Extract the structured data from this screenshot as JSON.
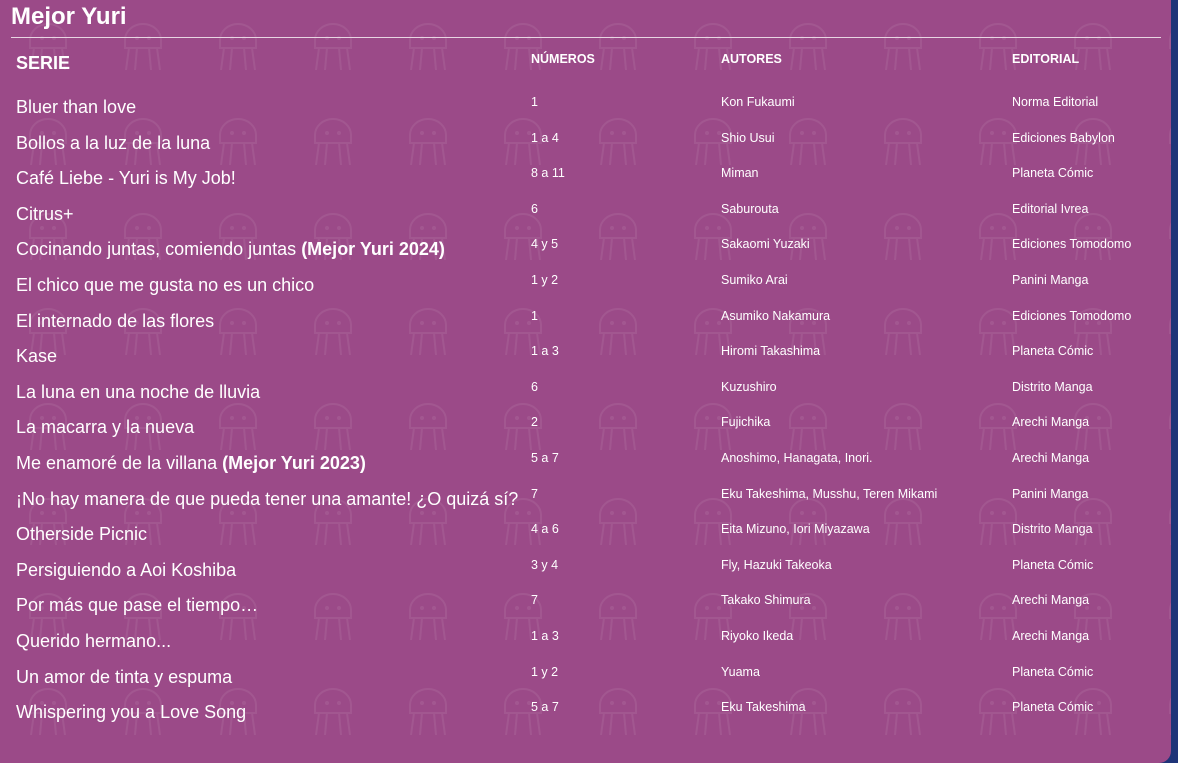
{
  "section": {
    "title": "Mejor Yuri"
  },
  "table": {
    "headers": {
      "serie": "SERIE",
      "numeros": "NÚMEROS",
      "autores": "AUTORES",
      "editorial": "EDITORIAL"
    },
    "rows": [
      {
        "serie": "Bluer than love",
        "award": "",
        "numeros": "1",
        "autores": "Kon Fukaumi",
        "editorial": "Norma Editorial"
      },
      {
        "serie": "Bollos a la luz de la luna",
        "award": "",
        "numeros": "1 a 4",
        "autores": "Shio Usui",
        "editorial": "Ediciones Babylon"
      },
      {
        "serie": "Café Liebe - Yuri is My Job!",
        "award": "",
        "numeros": "8 a 11",
        "autores": "Miman",
        "editorial": "Planeta Cómic"
      },
      {
        "serie": "Citrus+",
        "award": "",
        "numeros": "6",
        "autores": "Saburouta",
        "editorial": "Editorial Ivrea"
      },
      {
        "serie": "Cocinando juntas, comiendo juntas ",
        "award": "(Mejor Yuri 2024)",
        "numeros": "4 y 5",
        "autores": "Sakaomi Yuzaki",
        "editorial": "Ediciones Tomodomo"
      },
      {
        "serie": "El chico que me gusta no es un chico",
        "award": "",
        "numeros": "1 y 2",
        "autores": "Sumiko Arai",
        "editorial": "Panini Manga"
      },
      {
        "serie": "El internado de las flores",
        "award": "",
        "numeros": "1",
        "autores": "Asumiko Nakamura",
        "editorial": "Ediciones Tomodomo"
      },
      {
        "serie": "Kase",
        "award": "",
        "numeros": "1 a 3",
        "autores": "Hiromi Takashima",
        "editorial": "Planeta Cómic"
      },
      {
        "serie": "La luna en una noche de lluvia",
        "award": "",
        "numeros": "6",
        "autores": "Kuzushiro",
        "editorial": "Distrito Manga"
      },
      {
        "serie": "La macarra y la nueva",
        "award": "",
        "numeros": "2",
        "autores": "Fujichika",
        "editorial": "Arechi Manga"
      },
      {
        "serie": "Me enamoré de la villana ",
        "award": "(Mejor Yuri 2023)",
        "numeros": "5 a 7",
        "autores": "Anoshimo, Hanagata, Inori.",
        "editorial": "Arechi Manga"
      },
      {
        "serie": "¡No hay manera de que pueda tener una amante! ¿O quizá sí?",
        "award": "",
        "numeros": "7",
        "autores": "Eku Takeshima, Musshu, Teren Mikami",
        "editorial": "Panini Manga"
      },
      {
        "serie": "Otherside Picnic",
        "award": "",
        "numeros": "4 a 6",
        "autores": "Eita Mizuno, Iori Miyazawa",
        "editorial": "Distrito Manga"
      },
      {
        "serie": "Persiguiendo a Aoi Koshiba",
        "award": "",
        "numeros": "3 y 4",
        "autores": "Fly, Hazuki Takeoka",
        "editorial": "Planeta Cómic"
      },
      {
        "serie": "Por más que pase el tiempo…",
        "award": "",
        "numeros": "7",
        "autores": "Takako Shimura",
        "editorial": "Arechi Manga"
      },
      {
        "serie": "Querido hermano...",
        "award": "",
        "numeros": "1 a 3",
        "autores": "Riyoko Ikeda",
        "editorial": "Arechi Manga"
      },
      {
        "serie": "Un amor de tinta y espuma",
        "award": "",
        "numeros": "1 y 2",
        "autores": "Yuama",
        "editorial": "Planeta Cómic"
      },
      {
        "serie": "Whispering you a Love Song",
        "award": "",
        "numeros": "5 a 7",
        "autores": "Eku Takeshima",
        "editorial": "Planeta Cómic"
      }
    ]
  },
  "colors": {
    "panel": "#9b4a88",
    "page_background": "#1f3478",
    "text": "#ffffff"
  },
  "icons": {
    "background": "jellyfish-pattern-icon"
  }
}
